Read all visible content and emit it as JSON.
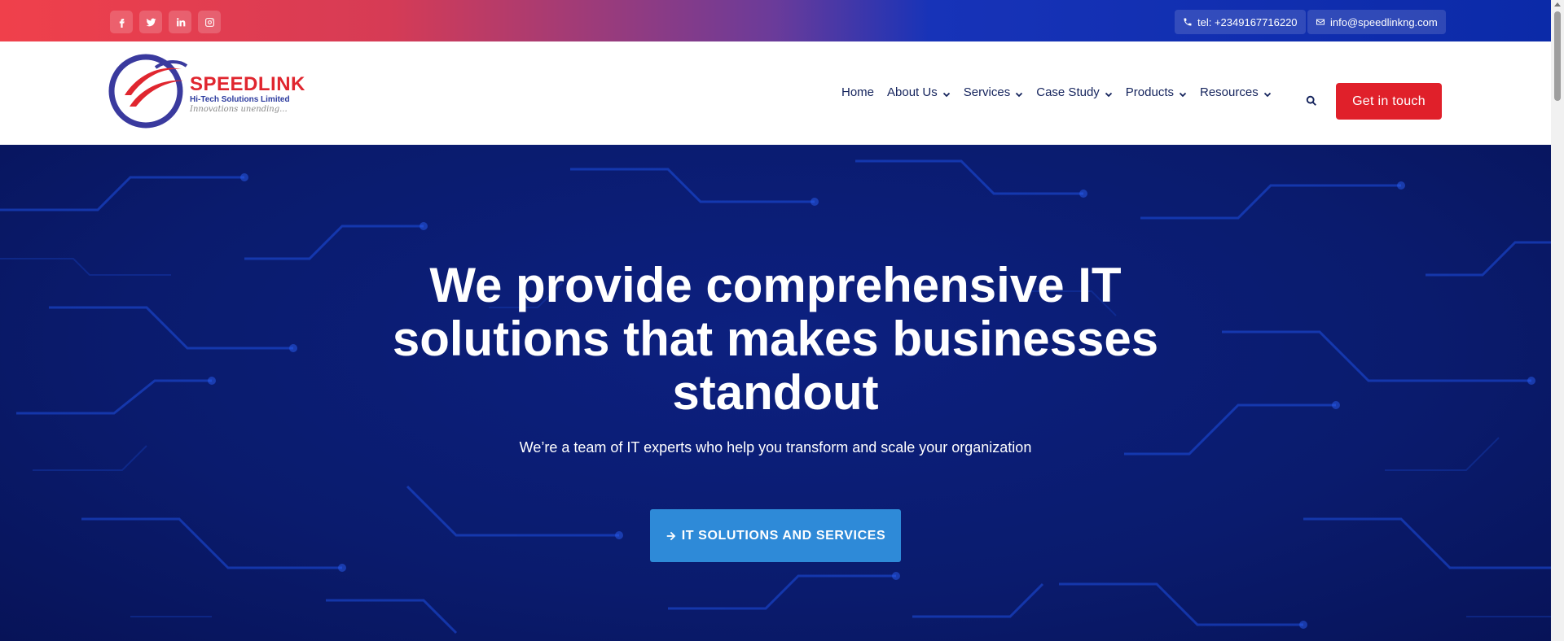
{
  "topbar": {
    "socials": [
      {
        "icon": "facebook-icon",
        "label": "f"
      },
      {
        "icon": "twitter-icon",
        "label": ""
      },
      {
        "icon": "linkedin-icon",
        "label": "in"
      },
      {
        "icon": "instagram-icon",
        "label": ""
      }
    ],
    "phone": "tel: +2349167716220",
    "email": "info@speedlinkng.com"
  },
  "logo": {
    "brand": "SPEEDLINK",
    "subtitle": "Hi-Tech Solutions Limited",
    "tagline": "Innovations unending..."
  },
  "nav": {
    "items": [
      {
        "label": "Home",
        "dropdown": false
      },
      {
        "label": "About Us",
        "dropdown": true
      },
      {
        "label": "Services",
        "dropdown": true
      },
      {
        "label": "Case Study",
        "dropdown": true
      },
      {
        "label": "Products",
        "dropdown": true
      },
      {
        "label": "Resources",
        "dropdown": true
      }
    ],
    "cta_label": "Get in touch"
  },
  "hero": {
    "title": "We provide comprehensive IT solutions that makes businesses standout",
    "subtitle": "We’re a team of IT experts who help you transform and scale your organization",
    "button_label": "IT SOLUTIONS AND SERVICES"
  },
  "colors": {
    "accent_red": "#e0202a",
    "nav_text": "#14235c",
    "hero_bg": "#0a1b6d",
    "hero_button": "#2e8ad8"
  }
}
